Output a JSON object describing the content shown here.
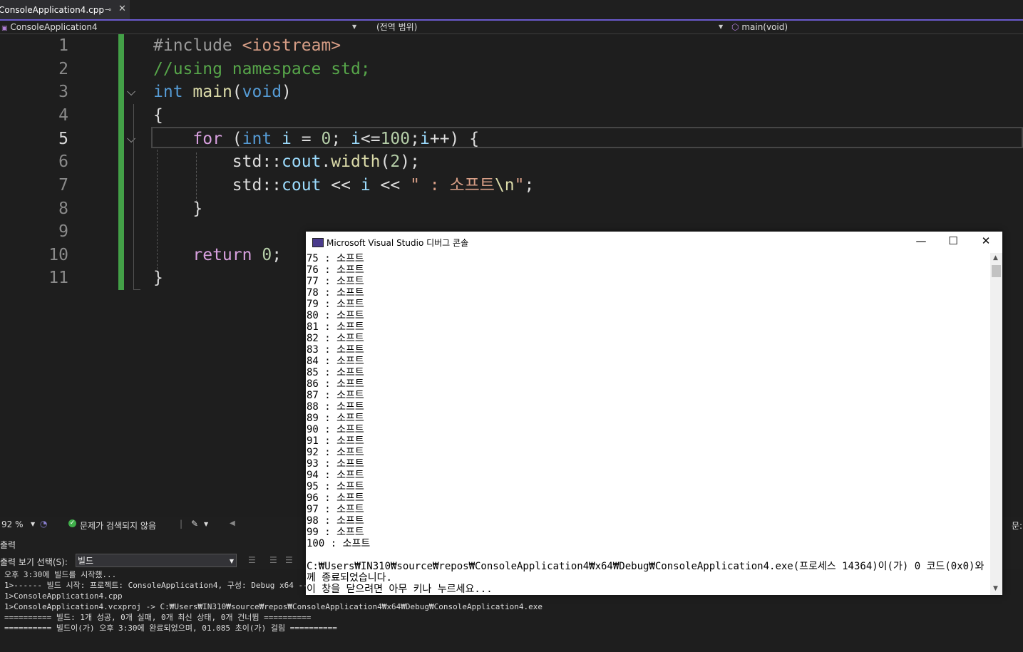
{
  "tab": {
    "title": "ConsoleApplication4.cpp",
    "pin_icon": "pin-icon",
    "close_icon": "close-icon"
  },
  "navbar": {
    "project": "ConsoleApplication4",
    "scope": "(전역 범위)",
    "member": "main(void)"
  },
  "editor": {
    "line_numbers": [
      "1",
      "2",
      "3",
      "4",
      "5",
      "6",
      "7",
      "8",
      "9",
      "10",
      "11"
    ],
    "current_line": 5
  },
  "status": {
    "zoom": "92 %",
    "issues": "문제가 검색되지 않음",
    "right_clip": "문:"
  },
  "output": {
    "title": "출력",
    "show_from_label": "출력 보기 선택(S):",
    "show_from_value": "빌드",
    "lines": [
      "오후 3:30에 빌드를 시작했...",
      "1>------ 빌드 시작: 프로젝트: ConsoleApplication4, 구성: Debug x64 ------",
      "1>ConsoleApplication4.cpp",
      "1>ConsoleApplication4.vcxproj -> C:₩Users₩IN310₩source₩repos₩ConsoleApplication4₩x64₩Debug₩ConsoleApplication4.exe",
      "========== 빌드: 1개 성공, 0개 실패, 0개 최신 상태, 0개 건너뜀 ==========",
      "========== 빌드이(가) 오후 3:30에 완료되었으며, 01.085 초이(가) 걸림 =========="
    ]
  },
  "console": {
    "title": "Microsoft Visual Studio 디버그 콘솔",
    "lines": [
      "75 : 소프트",
      "76 : 소프트",
      "77 : 소프트",
      "78 : 소프트",
      "79 : 소프트",
      "80 : 소프트",
      "81 : 소프트",
      "82 : 소프트",
      "83 : 소프트",
      "84 : 소프트",
      "85 : 소프트",
      "86 : 소프트",
      "87 : 소프트",
      "88 : 소프트",
      "89 : 소프트",
      "90 : 소프트",
      "91 : 소프트",
      "92 : 소프트",
      "93 : 소프트",
      "94 : 소프트",
      "95 : 소프트",
      "96 : 소프트",
      "97 : 소프트",
      "98 : 소프트",
      "99 : 소프트",
      "100 : 소프트",
      "",
      "C:₩Users₩IN310₩source₩repos₩ConsoleApplication4₩x64₩Debug₩ConsoleApplication4.exe(프로세스 14364)이(가) 0 코드(0x0)와 함",
      "께 종료되었습니다.",
      "이 창을 닫으려면 아무 키나 누르세요..."
    ]
  }
}
